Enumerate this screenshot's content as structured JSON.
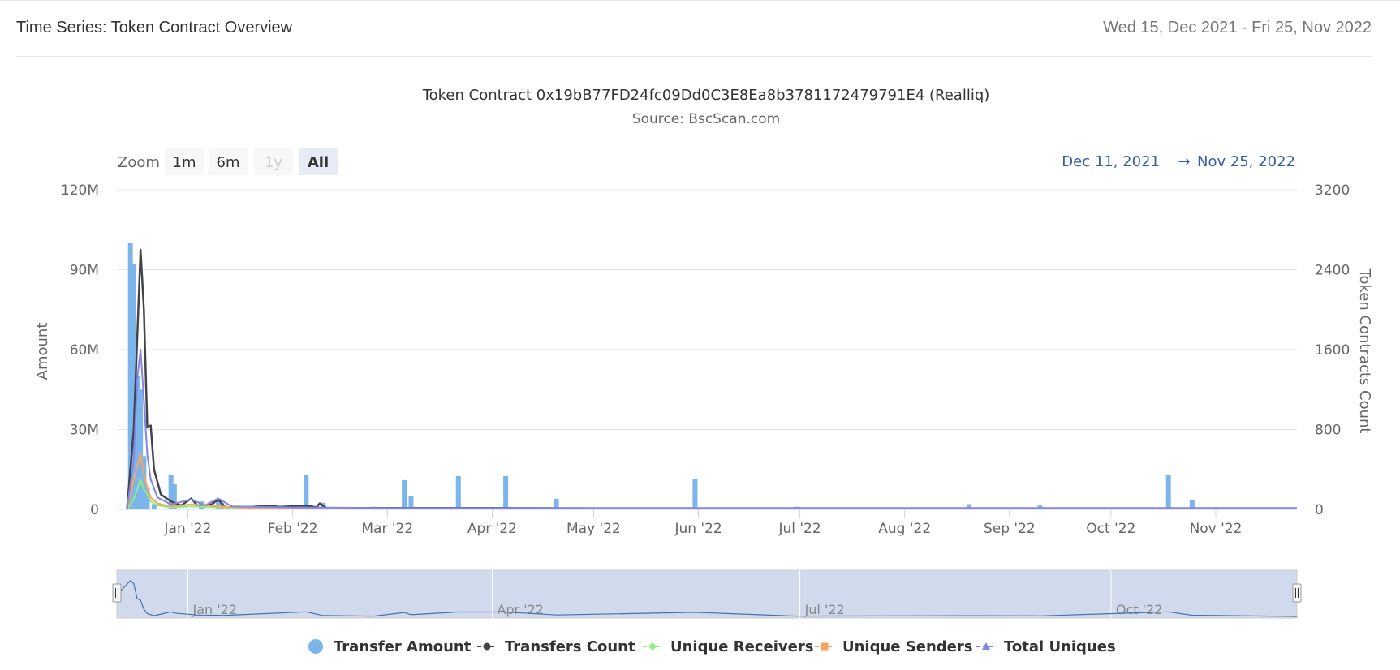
{
  "panel": {
    "title": "Time Series: Token Contract Overview",
    "date_range": "Wed 15, Dec 2021 - Fri 25, Nov 2022"
  },
  "zoom": {
    "label": "Zoom",
    "buttons": [
      {
        "label": "1m",
        "state": "normal"
      },
      {
        "label": "6m",
        "state": "normal"
      },
      {
        "label": "1y",
        "state": "disabled"
      },
      {
        "label": "All",
        "state": "selected"
      }
    ]
  },
  "range_selector": {
    "from": "Dec 11, 2021",
    "arrow": "→",
    "to": "Nov 25, 2022"
  },
  "navigator": {
    "labels": [
      "Jan '22",
      "Apr '22",
      "Jul '22",
      "Oct '22"
    ]
  },
  "chart_data": {
    "type": "bar",
    "title": "Token Contract 0x19bB77FD24fc09Dd0C3E8Ea8b3781172479791E4 (Realliq)",
    "subtitle": "Source: BscScan.com",
    "x_range": [
      "2021-12-11",
      "2022-11-25"
    ],
    "x_ticks": [
      "Jan '22",
      "Feb '22",
      "Mar '22",
      "Apr '22",
      "May '22",
      "Jun '22",
      "Jul '22",
      "Aug '22",
      "Sep '22",
      "Oct '22",
      "Nov '22"
    ],
    "y_left": {
      "label": "Amount",
      "min": 0,
      "max": 120000000,
      "tick_labels": [
        "0",
        "30M",
        "60M",
        "90M",
        "120M"
      ]
    },
    "y_right": {
      "label": "Token Contracts Count",
      "min": 0,
      "max": 3200,
      "tick_labels": [
        "0",
        "800",
        "1600",
        "2400",
        "3200"
      ]
    },
    "grid": true,
    "legend_placement": "bottom-center",
    "series": [
      {
        "name": "Transfer Amount",
        "type": "bar",
        "axis": "left",
        "color": "#7cb5ec",
        "marker": "circle",
        "points": [
          [
            "2021-12-15",
            100000000
          ],
          [
            "2021-12-16",
            92000000
          ],
          [
            "2021-12-17",
            50000000
          ],
          [
            "2021-12-18",
            45000000
          ],
          [
            "2021-12-19",
            20000000
          ],
          [
            "2021-12-20",
            8000000
          ],
          [
            "2021-12-22",
            2000000
          ],
          [
            "2021-12-27",
            13000000
          ],
          [
            "2021-12-28",
            9500000
          ],
          [
            "2022-01-05",
            3000000
          ],
          [
            "2022-01-10",
            3500000
          ],
          [
            "2022-01-11",
            2500000
          ],
          [
            "2022-02-05",
            13000000
          ],
          [
            "2022-02-10",
            2500000
          ],
          [
            "2022-02-25",
            1000000
          ],
          [
            "2022-03-06",
            11000000
          ],
          [
            "2022-03-08",
            5000000
          ],
          [
            "2022-03-22",
            12500000
          ],
          [
            "2022-04-05",
            12500000
          ],
          [
            "2022-04-20",
            4000000
          ],
          [
            "2022-05-31",
            11500000
          ],
          [
            "2022-06-30",
            1000000
          ],
          [
            "2022-08-20",
            2000000
          ],
          [
            "2022-09-10",
            1500000
          ],
          [
            "2022-10-18",
            13000000
          ],
          [
            "2022-10-25",
            3500000
          ]
        ]
      },
      {
        "name": "Transfers Count",
        "type": "line",
        "axis": "right",
        "color": "#434348",
        "marker": "circle",
        "points": [
          [
            "2021-12-14",
            0
          ],
          [
            "2021-12-16",
            800
          ],
          [
            "2021-12-18",
            2600
          ],
          [
            "2021-12-19",
            2000
          ],
          [
            "2021-12-20",
            820
          ],
          [
            "2021-12-21",
            840
          ],
          [
            "2021-12-22",
            400
          ],
          [
            "2021-12-24",
            150
          ],
          [
            "2021-12-27",
            80
          ],
          [
            "2021-12-30",
            40
          ],
          [
            "2022-01-02",
            110
          ],
          [
            "2022-01-04",
            30
          ],
          [
            "2022-01-08",
            50
          ],
          [
            "2022-01-10",
            100
          ],
          [
            "2022-01-12",
            20
          ],
          [
            "2022-01-20",
            25
          ],
          [
            "2022-01-25",
            40
          ],
          [
            "2022-01-28",
            25
          ],
          [
            "2022-02-05",
            40
          ],
          [
            "2022-02-08",
            20
          ],
          [
            "2022-02-09",
            60
          ],
          [
            "2022-02-11",
            15
          ],
          [
            "2022-03-01",
            15
          ],
          [
            "2022-04-01",
            15
          ],
          [
            "2022-05-01",
            10
          ],
          [
            "2022-06-01",
            10
          ],
          [
            "2022-07-01",
            10
          ],
          [
            "2022-08-01",
            10
          ],
          [
            "2022-09-01",
            10
          ],
          [
            "2022-10-01",
            10
          ],
          [
            "2022-11-25",
            10
          ]
        ]
      },
      {
        "name": "Unique Receivers",
        "type": "line",
        "axis": "right",
        "color": "#90ed7d",
        "marker": "diamond",
        "points": [
          [
            "2021-12-14",
            0
          ],
          [
            "2021-12-16",
            100
          ],
          [
            "2021-12-18",
            300
          ],
          [
            "2021-12-19",
            200
          ],
          [
            "2021-12-20",
            150
          ],
          [
            "2021-12-21",
            80
          ],
          [
            "2021-12-23",
            40
          ],
          [
            "2021-12-27",
            20
          ],
          [
            "2022-01-02",
            30
          ],
          [
            "2022-01-10",
            20
          ],
          [
            "2022-01-20",
            10
          ],
          [
            "2022-03-01",
            8
          ],
          [
            "2022-06-01",
            8
          ],
          [
            "2022-09-01",
            8
          ],
          [
            "2022-11-25",
            8
          ]
        ]
      },
      {
        "name": "Unique Senders",
        "type": "line",
        "axis": "right",
        "color": "#f7a35c",
        "marker": "square",
        "points": [
          [
            "2021-12-14",
            0
          ],
          [
            "2021-12-16",
            300
          ],
          [
            "2021-12-18",
            560
          ],
          [
            "2021-12-19",
            350
          ],
          [
            "2021-12-20",
            220
          ],
          [
            "2021-12-21",
            120
          ],
          [
            "2021-12-23",
            60
          ],
          [
            "2021-12-27",
            30
          ],
          [
            "2022-01-02",
            50
          ],
          [
            "2022-01-10",
            30
          ],
          [
            "2022-01-20",
            15
          ],
          [
            "2022-03-01",
            10
          ],
          [
            "2022-06-01",
            10
          ],
          [
            "2022-09-01",
            10
          ],
          [
            "2022-11-25",
            10
          ]
        ]
      },
      {
        "name": "Total Uniques",
        "type": "line",
        "axis": "right",
        "color": "#8085e9",
        "marker": "triangle",
        "points": [
          [
            "2021-12-14",
            0
          ],
          [
            "2021-12-16",
            500
          ],
          [
            "2021-12-17",
            1300
          ],
          [
            "2021-12-18",
            1600
          ],
          [
            "2021-12-19",
            1100
          ],
          [
            "2021-12-20",
            550
          ],
          [
            "2021-12-21",
            300
          ],
          [
            "2021-12-23",
            120
          ],
          [
            "2021-12-27",
            50
          ],
          [
            "2022-01-02",
            100
          ],
          [
            "2022-01-06",
            40
          ],
          [
            "2022-01-10",
            110
          ],
          [
            "2022-01-14",
            30
          ],
          [
            "2022-02-01",
            20
          ],
          [
            "2022-03-01",
            15
          ],
          [
            "2022-06-01",
            15
          ],
          [
            "2022-09-01",
            15
          ],
          [
            "2022-11-25",
            15
          ]
        ]
      }
    ]
  }
}
